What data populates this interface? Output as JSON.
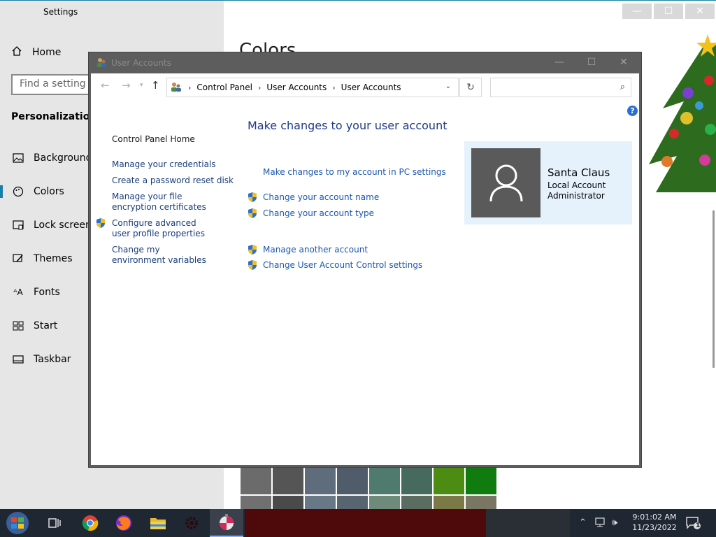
{
  "settings": {
    "title": "Settings",
    "home_label": "Home",
    "search_placeholder": "Find a setting",
    "section_label": "Personalization",
    "nav_items": [
      {
        "label": "Background",
        "icon": "image-icon"
      },
      {
        "label": "Colors",
        "icon": "palette-icon"
      },
      {
        "label": "Lock screen",
        "icon": "lock-screen-icon"
      },
      {
        "label": "Themes",
        "icon": "brush-icon"
      },
      {
        "label": "Fonts",
        "icon": "fonts-icon"
      },
      {
        "label": "Start",
        "icon": "start-icon"
      },
      {
        "label": "Taskbar",
        "icon": "taskbar-icon"
      }
    ],
    "active_item": "Colors",
    "page_heading": "Colors",
    "swatch_colors": [
      "#6b6b6b",
      "#555555",
      "#5e6c7c",
      "#515c6b",
      "#4f7a6e",
      "#476a5e",
      "#4c8c12",
      "#107c10",
      "#707070",
      "#4a4a4a",
      "#687886",
      "#58646f",
      "#6e8a7a",
      "#5b6c61",
      "#7b7a46",
      "#7a7664"
    ]
  },
  "user_accounts": {
    "window_title": "User Accounts",
    "breadcrumb": [
      "Control Panel",
      "User Accounts",
      "User Accounts"
    ],
    "search_placeholder": "",
    "sidebar": {
      "home": "Control Panel Home",
      "links": [
        {
          "text": "Manage your credentials",
          "shield": false
        },
        {
          "text": "Create a password reset disk",
          "shield": false
        },
        {
          "text": "Manage your file encryption certificates",
          "shield": false
        },
        {
          "text": "Configure advanced user profile properties",
          "shield": true
        },
        {
          "text": "Change my environment variables",
          "shield": false
        }
      ]
    },
    "main": {
      "title": "Make changes to your user account",
      "pc_settings_link": "Make changes to my account in PC settings",
      "change_name": "Change your account name",
      "change_type": "Change your account type",
      "manage_another": "Manage another account",
      "uac_settings": "Change User Account Control settings"
    },
    "account": {
      "name": "Santa Claus",
      "type": "Local Account",
      "role": "Administrator"
    }
  },
  "taskbar": {
    "time": "9:01:02 AM",
    "date": "11/23/2022",
    "notification_count": "1"
  }
}
